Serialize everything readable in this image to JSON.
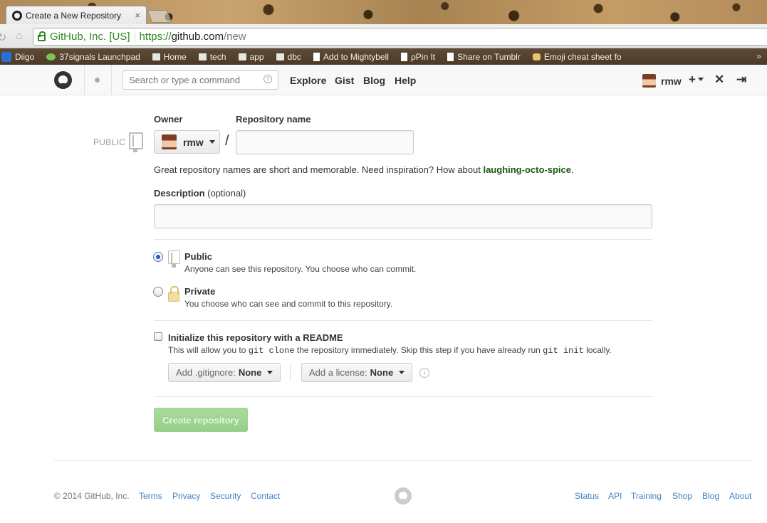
{
  "browser": {
    "tab_title": "Create a New Repository",
    "tab_close": "×",
    "ev_org": "GitHub, Inc. [US]",
    "url_scheme": "https://",
    "url_host": "github.com",
    "url_path": "/new",
    "bookmarks": [
      "Diigo",
      "37signals Launchpad",
      "Home",
      "tech",
      "app",
      "dbc",
      "Add to Mightybell",
      "ρPin It",
      "Share on Tumblr",
      "Emoji cheat sheet fo"
    ],
    "bookmarks_more": "»"
  },
  "header": {
    "search_placeholder": "Search or type a command",
    "search_help": "?",
    "nav": [
      "Explore",
      "Gist",
      "Blog",
      "Help"
    ],
    "username": "rmw",
    "plus": "+",
    "tools_icon": "✕",
    "signout_icon": "⇥"
  },
  "form": {
    "visibility_badge": "PUBLIC",
    "owner_label": "Owner",
    "owner_value": "rmw",
    "slash": "/",
    "repo_name_label": "Repository name",
    "repo_name_value": "",
    "hint_prefix": "Great repository names are short and memorable. Need inspiration? How about ",
    "hint_suggestion": "laughing-octo-spice",
    "hint_suffix": ".",
    "description_label": "Description",
    "description_optional": "(optional)",
    "description_value": "",
    "public_title": "Public",
    "public_desc": "Anyone can see this repository. You choose who can commit.",
    "public_selected": true,
    "private_title": "Private",
    "private_desc": "You choose who can see and commit to this repository.",
    "readme_title": "Initialize this repository with a README",
    "readme_desc_1": "This will allow you to ",
    "readme_code_1": "git clone",
    "readme_desc_2": " the repository immediately. Skip this step if you have already run ",
    "readme_code_2": "git init",
    "readme_desc_3": " locally.",
    "gitignore_label": "Add .gitignore:",
    "gitignore_value": "None",
    "license_label": "Add a license:",
    "license_value": "None",
    "info_icon": "i",
    "create_button": "Create repository"
  },
  "footer": {
    "copyright": "© 2014 GitHub, Inc.",
    "left_links": [
      "Terms",
      "Privacy",
      "Security",
      "Contact"
    ],
    "right_links": [
      "Status",
      "API",
      "Training",
      "Shop",
      "Blog",
      "About"
    ]
  }
}
